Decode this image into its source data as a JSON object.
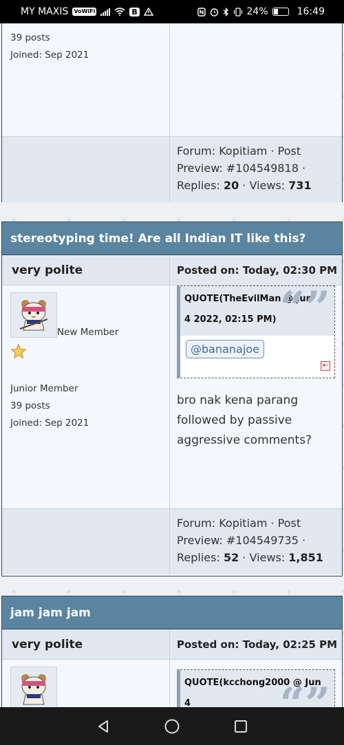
{
  "status_bar": {
    "carrier": "MY MAXIS",
    "vowifi": "VoWiFi",
    "b_badge": "B",
    "battery": "24%",
    "time": "16:49"
  },
  "post1": {
    "posts": "39 posts",
    "joined": "Joined: Sep 2021",
    "footer": {
      "forum_prefix": "Forum: ",
      "forum": "Kopitiam",
      "sep1": " · ",
      "post_preview": "Post Preview: #104549818",
      "sep2": " · ",
      "replies_label": "Replies: ",
      "replies": "20",
      "sep3": " · ",
      "views_label": "Views: ",
      "views": "731"
    }
  },
  "post2": {
    "title": "stereotyping time! Are all Indian IT like this?",
    "author": "very polite",
    "posted_on": "Posted on: Today, 02:30 PM",
    "rank": "New Member",
    "member_title": "Junior Member",
    "posts": "39 posts",
    "joined": "Joined: Sep 2021",
    "quote_head": "QUOTE(TheEvilMan @ Jun 4 2022, 02:15 PM)",
    "mention": "@bananajoe",
    "text": "bro nak kena parang followed by passive aggressive comments?",
    "footer": {
      "forum_prefix": "Forum: ",
      "forum": "Kopitiam",
      "sep1": " · ",
      "post_preview": "Post Preview: #104549735",
      "sep2": " · ",
      "replies_label": "Replies: ",
      "replies": "52",
      "sep3": " · ",
      "views_label": "Views: ",
      "views": "1,851"
    }
  },
  "post3": {
    "title": "jam jam jam",
    "author": "very polite",
    "posted_on": "Posted on: Today, 02:25 PM",
    "quote_head": "QUOTE(kcchong2000 @ Jun 4"
  },
  "icons": {
    "quote_marks": "“”",
    "jump": "⇤"
  }
}
